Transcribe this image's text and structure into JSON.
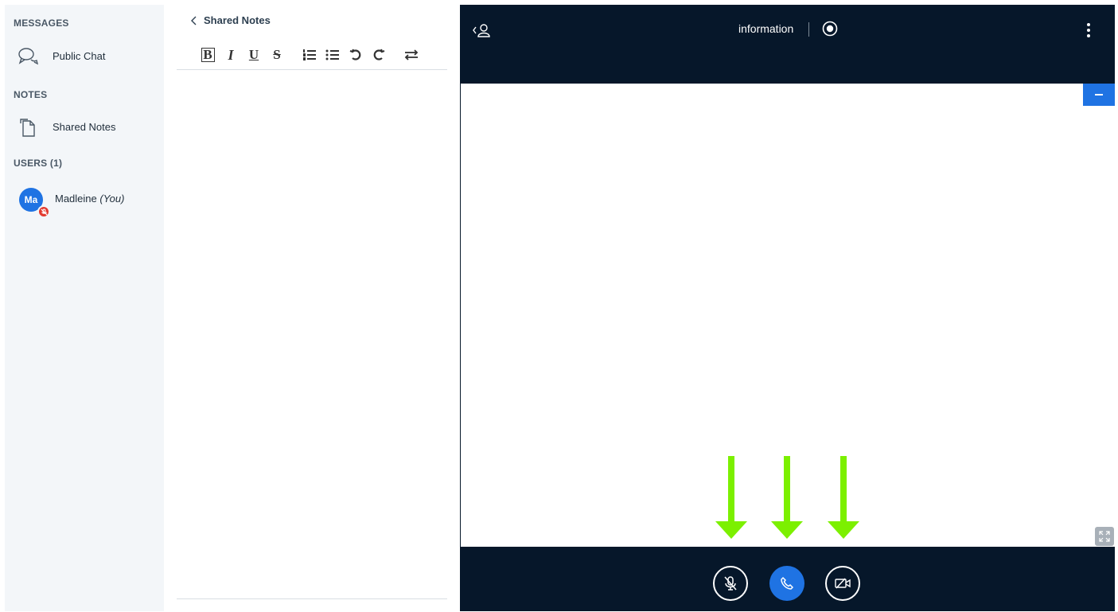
{
  "sidebar": {
    "messages_title": "MESSAGES",
    "public_chat_label": "Public Chat",
    "notes_title": "NOTES",
    "shared_notes_label": "Shared Notes",
    "users_title": "USERS (1)",
    "user": {
      "initials": "Ma",
      "name": "Madleine",
      "you_label": "(You)",
      "avatar_color": "#1f73e3",
      "muted_badge_color": "#e23a2f"
    }
  },
  "notes_panel": {
    "back_label": "Shared Notes",
    "toolbar": {
      "bold": "B",
      "italic": "I",
      "underline": "U",
      "strike": "S"
    }
  },
  "main": {
    "meeting_title": "information",
    "accent_color": "#1f73e3",
    "background_color": "#06172a",
    "arrow_color": "#7cf000"
  },
  "icons": {
    "sidebar": [
      "chat-bubbles-icon",
      "documents-icon"
    ],
    "toolbar": [
      "bold-icon",
      "italic-icon",
      "underline-icon",
      "strikethrough-icon",
      "ordered-list-icon",
      "unordered-list-icon",
      "undo-icon",
      "redo-icon",
      "swap-icon"
    ],
    "main": [
      "user-list-toggle-icon",
      "record-icon",
      "more-options-icon",
      "minimize-icon",
      "fullscreen-icon",
      "microphone-muted-icon",
      "phone-icon",
      "camera-off-icon"
    ]
  }
}
